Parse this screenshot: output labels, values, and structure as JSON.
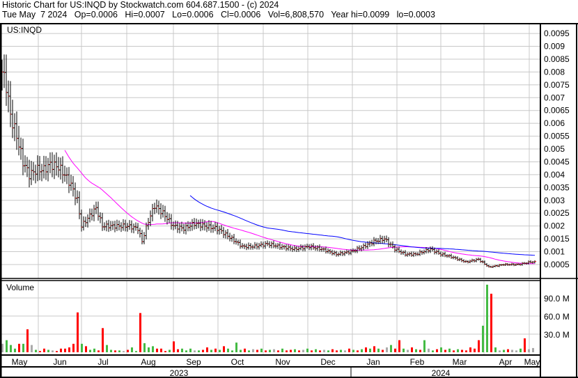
{
  "header": {
    "line1": "Historic Chart for US:INQD by Stockwatch.com 604.687.1500 - (c) 2024",
    "line2": "Tue May  7 2024   Op=0.0006   Hi=0.0007   Lo=0.0006   Cl=0.0006   Vol=6,808,570   Year hi=0.0099   lo=0.0003"
  },
  "chart_data": {
    "type": "ohlc+volume",
    "symbol_label": "US:INQD",
    "volume_label": "Volume",
    "price_ticks": [
      "0.0005",
      "0.001",
      "0.0015",
      "0.002",
      "0.0025",
      "0.003",
      "0.0035",
      "0.004",
      "0.0045",
      "0.005",
      "0.0055",
      "0.006",
      "0.0065",
      "0.007",
      "0.0075",
      "0.008",
      "0.0085",
      "0.009",
      "0.0095"
    ],
    "volume_ticks": [
      "30.0 M",
      "60.0 M",
      "90.0 M"
    ],
    "months": [
      "May",
      "Jun",
      "Jul",
      "Aug",
      "Sep",
      "Oct",
      "Nov",
      "Dec",
      "Jan",
      "Feb",
      "Mar",
      "Apr",
      "May"
    ],
    "years": [
      "2023",
      "2024"
    ],
    "ylim": [
      0.0003,
      0.0099
    ],
    "moving_averages": [
      {
        "period": 30,
        "color": "#ff00ff"
      },
      {
        "period": 90,
        "color": "#0000ff"
      }
    ],
    "close_anchors": [
      [
        0,
        0.008
      ],
      [
        2,
        0.0075
      ],
      [
        4,
        0.0063
      ],
      [
        7,
        0.0055
      ],
      [
        10,
        0.0045
      ],
      [
        13,
        0.004
      ],
      [
        17,
        0.0042
      ],
      [
        20,
        0.0042
      ],
      [
        23,
        0.0044
      ],
      [
        27,
        0.0043
      ],
      [
        30,
        0.004
      ],
      [
        33,
        0.0036
      ],
      [
        36,
        0.003
      ],
      [
        38,
        0.002
      ],
      [
        42,
        0.0024
      ],
      [
        45,
        0.0027
      ],
      [
        48,
        0.002
      ],
      [
        53,
        0.002
      ],
      [
        60,
        0.002
      ],
      [
        65,
        0.0019
      ],
      [
        67,
        0.0014
      ],
      [
        70,
        0.0022
      ],
      [
        73,
        0.0028
      ],
      [
        77,
        0.0025
      ],
      [
        82,
        0.002
      ],
      [
        87,
        0.0019
      ],
      [
        92,
        0.0021
      ],
      [
        97,
        0.002
      ],
      [
        103,
        0.0019
      ],
      [
        110,
        0.0015
      ],
      [
        115,
        0.0012
      ],
      [
        120,
        0.0012
      ],
      [
        127,
        0.0013
      ],
      [
        133,
        0.0012
      ],
      [
        140,
        0.0011
      ],
      [
        147,
        0.0012
      ],
      [
        153,
        0.0011
      ],
      [
        160,
        0.0009
      ],
      [
        167,
        0.001
      ],
      [
        173,
        0.0012
      ],
      [
        178,
        0.0014
      ],
      [
        183,
        0.0015
      ],
      [
        188,
        0.0011
      ],
      [
        193,
        0.0009
      ],
      [
        198,
        0.0009
      ],
      [
        205,
        0.0011
      ],
      [
        210,
        0.0009
      ],
      [
        215,
        0.0008
      ],
      [
        222,
        0.0006
      ],
      [
        228,
        0.0007
      ],
      [
        233,
        0.0004
      ],
      [
        240,
        0.0005
      ],
      [
        247,
        0.0005
      ],
      [
        253,
        0.0006
      ],
      [
        255,
        0.0006
      ]
    ],
    "volume_millions": [
      14,
      20,
      12,
      6,
      14,
      14,
      38,
      12,
      4,
      2,
      6,
      4,
      3,
      2,
      6,
      6,
      8,
      14,
      66,
      14,
      10,
      4,
      6,
      3,
      40,
      12,
      4,
      3,
      3,
      2,
      4,
      8,
      2,
      65,
      15,
      8,
      10,
      6,
      6,
      2,
      4,
      18,
      5,
      6,
      3,
      6,
      3,
      3,
      4,
      8,
      4,
      6,
      4,
      10,
      6,
      3,
      16,
      4,
      6,
      3,
      5,
      4,
      6,
      3,
      4,
      5,
      3,
      6,
      3,
      4,
      5,
      3,
      4,
      6,
      3,
      5,
      3,
      4,
      3,
      5,
      3,
      4,
      3,
      6,
      4,
      3,
      5,
      8,
      6,
      10,
      6,
      4,
      8,
      12,
      6,
      20,
      6,
      4,
      8,
      5,
      4,
      20,
      6,
      3,
      5,
      8,
      4,
      6,
      3,
      5,
      4,
      3,
      8,
      6,
      20,
      44,
      112,
      97,
      8,
      3,
      4,
      5,
      4,
      3,
      6,
      23,
      5,
      7
    ],
    "volume_colors": "kgggrgrkgrrgkrrrrrrgrggrrggrgkrggrgggrrrgrrgggkgrrgrgrggggrgkrgrgkrgrrgrkgrgrkgrrgkrgrgrgrgrkgrrgkrgrgkgrgrgrgrrrrrggrgkgrkkgrk"
  }
}
